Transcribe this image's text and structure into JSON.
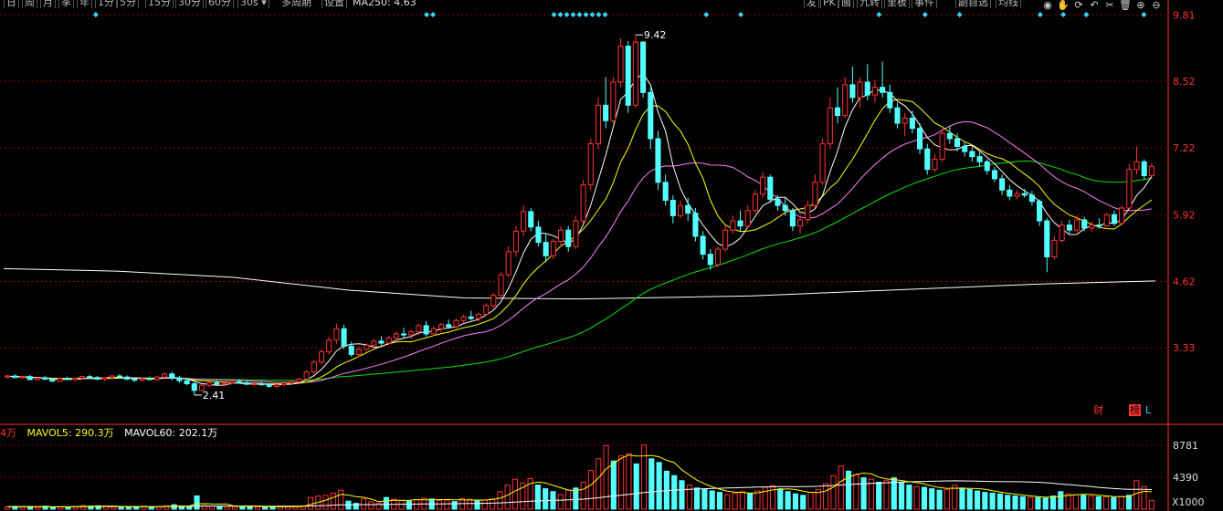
{
  "toolbar": {
    "period_buttons": [
      "日",
      "周",
      "月",
      "季",
      "年",
      "1分",
      "5分",
      "15分",
      "30分",
      "60分"
    ],
    "interval_select": "30s",
    "multi_period": "多周期",
    "settings": "设置",
    "ma250_label": "MA250: 4.63",
    "right_buttons": [
      "发",
      "PK",
      "画",
      "九转",
      "里板",
      "事件",
      "副自选",
      "均线"
    ],
    "icon_names": [
      "eye-icon",
      "hand-icon",
      "refresh-icon",
      "undo-icon",
      "scissors-icon",
      "trash-icon",
      "zoom-in-icon",
      "zoom-out-icon"
    ]
  },
  "badges": {
    "cai": "财",
    "bang": "榜",
    "l": "L"
  },
  "colors": {
    "up": "#ff3232",
    "down": "#54ffff",
    "ma5": "#ffffff",
    "ma10": "#ffff00",
    "ma20": "#ff80ff",
    "ma60": "#00e600",
    "ma250": "#ffffff",
    "grid": "#8b0000",
    "axis": "#ff3232",
    "diamond": "#3ad6ff",
    "vol_ma5": "#ffff00",
    "vol_ma60": "#ffffff"
  },
  "chart_data": [
    {
      "type": "candlestick",
      "y_ticks": [
        "9.81",
        "8.52",
        "7.22",
        "5.92",
        "4.62",
        "3.33"
      ],
      "ylim": [
        2.0,
        9.85
      ],
      "annotations": [
        {
          "text": "9.42",
          "value": 9.42
        },
        {
          "text": "2.41",
          "value": 2.41
        }
      ],
      "ma_lines": [
        "MA5",
        "MA10",
        "MA20",
        "MA60",
        "MA250"
      ],
      "ohlc": [
        [
          2.76,
          2.8,
          2.73,
          2.78
        ],
        [
          2.78,
          2.81,
          2.75,
          2.75
        ],
        [
          2.75,
          2.79,
          2.72,
          2.77
        ],
        [
          2.77,
          2.8,
          2.7,
          2.71
        ],
        [
          2.71,
          2.76,
          2.69,
          2.74
        ],
        [
          2.74,
          2.78,
          2.7,
          2.72
        ],
        [
          2.72,
          2.74,
          2.66,
          2.68
        ],
        [
          2.68,
          2.74,
          2.66,
          2.73
        ],
        [
          2.73,
          2.77,
          2.7,
          2.71
        ],
        [
          2.71,
          2.75,
          2.68,
          2.74
        ],
        [
          2.74,
          2.79,
          2.72,
          2.77
        ],
        [
          2.77,
          2.8,
          2.73,
          2.75
        ],
        [
          2.75,
          2.78,
          2.7,
          2.72
        ],
        [
          2.72,
          2.76,
          2.68,
          2.75
        ],
        [
          2.75,
          2.8,
          2.72,
          2.78
        ],
        [
          2.78,
          2.82,
          2.74,
          2.76
        ],
        [
          2.76,
          2.79,
          2.7,
          2.72
        ],
        [
          2.72,
          2.75,
          2.66,
          2.7
        ],
        [
          2.7,
          2.75,
          2.67,
          2.73
        ],
        [
          2.73,
          2.77,
          2.7,
          2.71
        ],
        [
          2.71,
          2.78,
          2.69,
          2.76
        ],
        [
          2.76,
          2.85,
          2.73,
          2.82
        ],
        [
          2.82,
          2.86,
          2.7,
          2.74
        ],
        [
          2.74,
          2.78,
          2.65,
          2.69
        ],
        [
          2.69,
          2.73,
          2.6,
          2.63
        ],
        [
          2.63,
          2.66,
          2.41,
          2.5
        ],
        [
          2.5,
          2.62,
          2.48,
          2.6
        ],
        [
          2.6,
          2.68,
          2.56,
          2.65
        ],
        [
          2.65,
          2.7,
          2.6,
          2.62
        ],
        [
          2.62,
          2.67,
          2.58,
          2.64
        ],
        [
          2.64,
          2.7,
          2.61,
          2.67
        ],
        [
          2.67,
          2.72,
          2.63,
          2.65
        ],
        [
          2.65,
          2.69,
          2.6,
          2.62
        ],
        [
          2.62,
          2.66,
          2.58,
          2.63
        ],
        [
          2.63,
          2.67,
          2.59,
          2.61
        ],
        [
          2.61,
          2.64,
          2.55,
          2.58
        ],
        [
          2.58,
          2.63,
          2.55,
          2.61
        ],
        [
          2.61,
          2.66,
          2.58,
          2.64
        ],
        [
          2.64,
          2.7,
          2.61,
          2.67
        ],
        [
          2.67,
          2.75,
          2.64,
          2.72
        ],
        [
          2.72,
          2.9,
          2.7,
          2.86
        ],
        [
          2.86,
          3.1,
          2.82,
          3.05
        ],
        [
          3.05,
          3.3,
          3.0,
          3.25
        ],
        [
          3.25,
          3.55,
          3.2,
          3.48
        ],
        [
          3.48,
          3.8,
          3.4,
          3.7
        ],
        [
          3.7,
          3.78,
          3.3,
          3.36
        ],
        [
          3.36,
          3.45,
          3.15,
          3.2
        ],
        [
          3.2,
          3.35,
          3.15,
          3.3
        ],
        [
          3.3,
          3.42,
          3.25,
          3.38
        ],
        [
          3.38,
          3.5,
          3.32,
          3.46
        ],
        [
          3.46,
          3.55,
          3.38,
          3.42
        ],
        [
          3.42,
          3.56,
          3.38,
          3.52
        ],
        [
          3.52,
          3.65,
          3.46,
          3.6
        ],
        [
          3.6,
          3.72,
          3.52,
          3.58
        ],
        [
          3.58,
          3.68,
          3.5,
          3.64
        ],
        [
          3.64,
          3.8,
          3.58,
          3.76
        ],
        [
          3.76,
          3.85,
          3.55,
          3.6
        ],
        [
          3.6,
          3.75,
          3.56,
          3.7
        ],
        [
          3.7,
          3.82,
          3.64,
          3.78
        ],
        [
          3.78,
          3.88,
          3.7,
          3.74
        ],
        [
          3.74,
          3.9,
          3.7,
          3.86
        ],
        [
          3.86,
          3.98,
          3.8,
          3.93
        ],
        [
          3.93,
          4.05,
          3.86,
          3.9
        ],
        [
          3.9,
          4.02,
          3.84,
          3.98
        ],
        [
          3.98,
          4.2,
          3.95,
          4.15
        ],
        [
          4.15,
          4.4,
          4.1,
          4.35
        ],
        [
          4.35,
          4.8,
          4.3,
          4.75
        ],
        [
          4.75,
          5.3,
          4.7,
          5.2
        ],
        [
          5.2,
          5.7,
          5.1,
          5.6
        ],
        [
          5.6,
          6.1,
          5.5,
          5.98
        ],
        [
          5.98,
          6.05,
          5.6,
          5.68
        ],
        [
          5.68,
          5.8,
          5.3,
          5.38
        ],
        [
          5.38,
          5.55,
          5.0,
          5.12
        ],
        [
          5.12,
          5.45,
          5.05,
          5.4
        ],
        [
          5.4,
          5.7,
          5.3,
          5.62
        ],
        [
          5.62,
          5.7,
          5.2,
          5.3
        ],
        [
          5.3,
          5.9,
          5.25,
          5.8
        ],
        [
          5.8,
          6.6,
          5.75,
          6.5
        ],
        [
          6.5,
          7.4,
          6.4,
          7.3
        ],
        [
          7.3,
          8.2,
          7.2,
          8.05
        ],
        [
          8.05,
          8.6,
          7.6,
          7.75
        ],
        [
          7.75,
          8.6,
          7.7,
          8.5
        ],
        [
          8.5,
          9.35,
          8.4,
          9.2
        ],
        [
          9.2,
          9.3,
          7.9,
          8.05
        ],
        [
          8.05,
          9.42,
          8.0,
          9.28
        ],
        [
          9.28,
          9.3,
          8.2,
          8.3
        ],
        [
          8.3,
          8.4,
          7.2,
          7.4
        ],
        [
          7.4,
          7.55,
          6.4,
          6.55
        ],
        [
          6.55,
          6.7,
          6.1,
          6.2
        ],
        [
          6.2,
          6.3,
          5.75,
          5.9
        ],
        [
          5.9,
          6.2,
          5.85,
          6.1
        ],
        [
          6.1,
          6.25,
          5.8,
          5.95
        ],
        [
          5.95,
          6.05,
          5.4,
          5.5
        ],
        [
          5.5,
          5.6,
          5.05,
          5.15
        ],
        [
          5.15,
          5.25,
          4.85,
          4.95
        ],
        [
          4.95,
          5.3,
          4.9,
          5.25
        ],
        [
          5.25,
          5.7,
          5.2,
          5.62
        ],
        [
          5.62,
          5.9,
          5.55,
          5.8
        ],
        [
          5.8,
          6.0,
          5.6,
          5.7
        ],
        [
          5.7,
          6.1,
          5.65,
          6.0
        ],
        [
          6.0,
          6.4,
          5.95,
          6.32
        ],
        [
          6.32,
          6.75,
          6.25,
          6.65
        ],
        [
          6.65,
          6.7,
          6.15,
          6.22
        ],
        [
          6.22,
          6.3,
          6.0,
          6.1
        ],
        [
          6.1,
          6.25,
          5.9,
          6.0
        ],
        [
          6.0,
          6.05,
          5.6,
          5.7
        ],
        [
          5.7,
          5.9,
          5.55,
          5.82
        ],
        [
          5.82,
          6.2,
          5.75,
          6.1
        ],
        [
          6.1,
          6.7,
          6.05,
          6.55
        ],
        [
          6.55,
          7.4,
          6.5,
          7.3
        ],
        [
          7.3,
          8.2,
          7.2,
          8.0
        ],
        [
          8.0,
          8.4,
          7.7,
          7.85
        ],
        [
          7.85,
          8.6,
          7.8,
          8.45
        ],
        [
          8.45,
          8.8,
          8.1,
          8.2
        ],
        [
          8.2,
          8.6,
          8.0,
          8.5
        ],
        [
          8.5,
          8.85,
          8.15,
          8.25
        ],
        [
          8.25,
          8.55,
          8.1,
          8.4
        ],
        [
          8.4,
          8.9,
          8.2,
          8.3
        ],
        [
          8.3,
          8.45,
          7.9,
          8.0
        ],
        [
          8.0,
          8.1,
          7.6,
          7.7
        ],
        [
          7.7,
          7.9,
          7.45,
          7.8
        ],
        [
          7.8,
          7.95,
          7.5,
          7.6
        ],
        [
          7.6,
          7.7,
          7.1,
          7.2
        ],
        [
          7.2,
          7.3,
          6.7,
          6.8
        ],
        [
          6.8,
          7.1,
          6.75,
          7.0
        ],
        [
          7.0,
          7.6,
          6.95,
          7.5
        ],
        [
          7.5,
          7.65,
          7.3,
          7.4
        ],
        [
          7.4,
          7.5,
          7.15,
          7.25
        ],
        [
          7.25,
          7.35,
          7.05,
          7.15
        ],
        [
          7.15,
          7.25,
          6.95,
          7.05
        ],
        [
          7.05,
          7.15,
          6.85,
          6.95
        ],
        [
          6.95,
          7.0,
          6.7,
          6.78
        ],
        [
          6.78,
          6.85,
          6.55,
          6.62
        ],
        [
          6.62,
          6.7,
          6.3,
          6.4
        ],
        [
          6.4,
          6.5,
          6.2,
          6.28
        ],
        [
          6.28,
          6.4,
          6.22,
          6.33
        ],
        [
          6.33,
          6.42,
          6.25,
          6.3
        ],
        [
          6.3,
          6.38,
          6.1,
          6.18
        ],
        [
          6.18,
          6.22,
          5.7,
          5.8
        ],
        [
          5.8,
          5.85,
          4.8,
          5.1
        ],
        [
          5.1,
          5.5,
          5.05,
          5.42
        ],
        [
          5.42,
          5.8,
          5.38,
          5.72
        ],
        [
          5.72,
          5.82,
          5.55,
          5.62
        ],
        [
          5.62,
          5.9,
          5.58,
          5.82
        ],
        [
          5.82,
          5.88,
          5.6,
          5.66
        ],
        [
          5.66,
          5.78,
          5.58,
          5.72
        ],
        [
          5.72,
          5.85,
          5.65,
          5.7
        ],
        [
          5.7,
          5.96,
          5.68,
          5.92
        ],
        [
          5.92,
          6.0,
          5.7,
          5.75
        ],
        [
          5.75,
          6.1,
          5.72,
          6.05
        ],
        [
          6.05,
          6.9,
          6.0,
          6.8
        ],
        [
          6.8,
          7.25,
          6.7,
          6.95
        ],
        [
          6.95,
          7.0,
          6.6,
          6.68
        ],
        [
          6.68,
          6.92,
          6.62,
          6.86
        ]
      ],
      "ma250": [
        [
          0,
          4.87
        ],
        [
          0.1,
          4.82
        ],
        [
          0.2,
          4.7
        ],
        [
          0.3,
          4.45
        ],
        [
          0.4,
          4.3
        ],
        [
          0.5,
          4.28
        ],
        [
          0.65,
          4.34
        ],
        [
          0.8,
          4.48
        ],
        [
          0.9,
          4.57
        ],
        [
          1.0,
          4.63
        ]
      ],
      "markers_top": [
        0.08,
        0.37,
        0.37,
        0.5,
        0.5,
        0.5,
        0.5,
        0.5,
        0.5,
        0.5,
        0.5,
        0.5,
        0.61,
        0.64,
        0.76,
        0.8,
        0.83,
        0.9,
        0.92,
        0.94,
        0.99
      ]
    },
    {
      "type": "bar",
      "series_labels": [
        "4万",
        "MAVOL5: 290.3万",
        "MAVOL60: 202.1万"
      ],
      "y_ticks": [
        "8781",
        "4390",
        "X1000"
      ],
      "ylim": [
        0,
        9500
      ],
      "volumes": [
        320,
        380,
        300,
        350,
        290,
        410,
        260,
        330,
        310,
        370,
        500,
        420,
        460,
        380,
        340,
        300,
        280,
        360,
        390,
        320,
        330,
        460,
        610,
        420,
        390,
        1820,
        480,
        450,
        380,
        360,
        340,
        420,
        410,
        330,
        300,
        270,
        330,
        380,
        420,
        470,
        1600,
        1800,
        1900,
        2200,
        2600,
        1100,
        800,
        1400,
        1000,
        850,
        1600,
        1350,
        1200,
        1100,
        1300,
        1500,
        1400,
        1200,
        1250,
        1050,
        1450,
        1350,
        1150,
        1250,
        1400,
        2400,
        3300,
        4100,
        3600,
        4200,
        3300,
        2800,
        2400,
        2000,
        2600,
        2900,
        3700,
        5300,
        6900,
        8700,
        6600,
        7300,
        7600,
        6200,
        8800,
        6900,
        6400,
        5200,
        4600,
        3900,
        3300,
        2900,
        2700,
        2500,
        2300,
        2000,
        2200,
        2400,
        2100,
        2500,
        3000,
        3200,
        2800,
        2400,
        2100,
        1900,
        2300,
        2700,
        3500,
        4600,
        5900,
        5200,
        4700,
        4300,
        4100,
        3700,
        3900,
        4300,
        3600,
        3300,
        3100,
        3000,
        2800,
        2600,
        2700,
        3300,
        2900,
        2700,
        2500,
        2300,
        2200,
        2100,
        1900,
        1800,
        1700,
        1600,
        1600,
        1500,
        1800,
        2400,
        2100,
        2000,
        1900,
        1800,
        1700,
        1700,
        1600,
        1750,
        1900,
        3900,
        3100,
        1200
      ]
    }
  ]
}
